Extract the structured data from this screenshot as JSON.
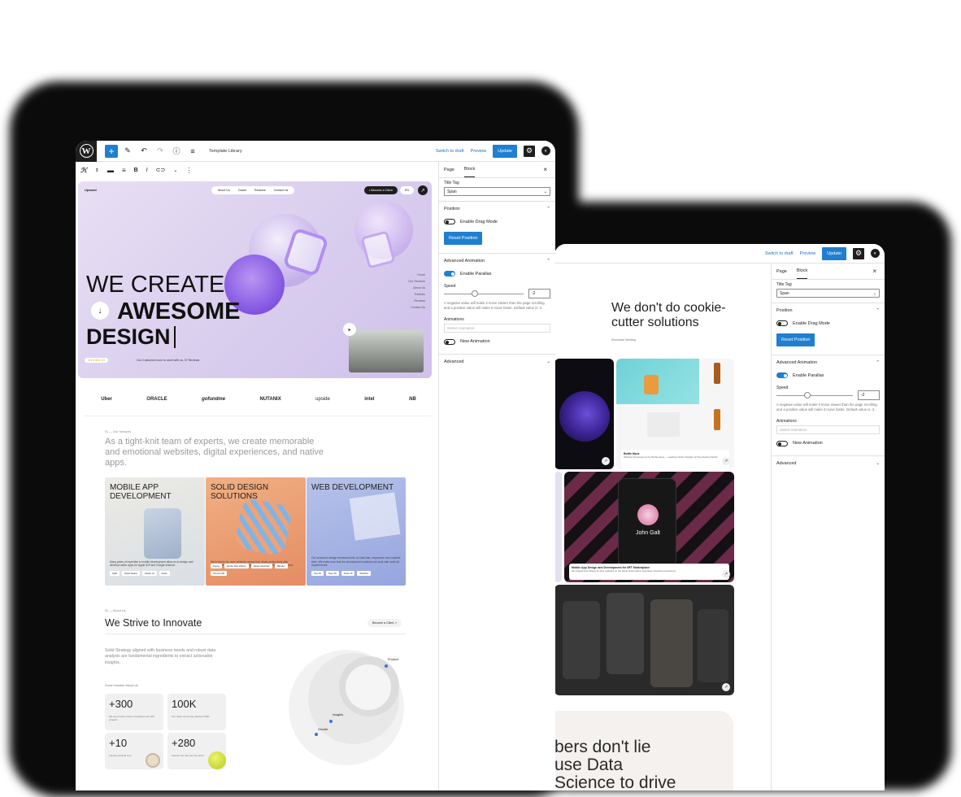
{
  "editor_left": {
    "toolbar": {
      "doc_title": "Template Library",
      "switch_draft": "Switch to draft",
      "preview": "Preview",
      "update": "Update"
    },
    "sidebar": {
      "tab_page": "Page",
      "tab_block": "Block",
      "title_tag_label": "Title Tag",
      "title_tag_value": "Span",
      "position_label": "Position",
      "drag_mode_label": "Enable Drag Mode",
      "reset_position": "Reset Position",
      "advanced_animation_label": "Advanced Animation",
      "parallax_label": "Enable Parallax",
      "speed_label": "Speed",
      "speed_value": "-2",
      "speed_help": "A negative value will make it move slower than the page scrolling, and a positive value will make it move faster. Default value is -2.",
      "animations_label": "Animations",
      "animations_placeholder": "Select Animation",
      "new_animation_label": "New Animation",
      "advanced_label": "Advanced"
    }
  },
  "site": {
    "brand": "Upward",
    "nav": [
      "About Us",
      "Cases",
      "Reviews",
      "Contact Us"
    ],
    "become_client": "Become a Client",
    "lang": "EN",
    "side_menu": [
      "Home",
      "Our Services",
      "About Us",
      "Portfolio",
      "Reviews",
      "Contact Us"
    ],
    "hero_line1": "WE CREATE",
    "hero_line2": "AWESOME",
    "hero_line3": "DESIGN",
    "hero_review": "Our Customers love to work with us, 37 Reviews",
    "logos": [
      "Uber",
      "ORACLE",
      "gofundme",
      "NUTANIX",
      "upside",
      "intel",
      "NB"
    ],
    "services_kicker": "01 — Our Services",
    "services_intro": "As a tight-knit team of experts, we create memorable and emotional websites, digital experiences, and native apps.",
    "cards": [
      {
        "title": "MOBILE APP DEVELOPMENT",
        "text": "Many years of expertise in mobile development allow us to design and develop native apps for Apple iOS and Google Android.",
        "tags": [
          "Swift",
          "React Native",
          "Flutter UI",
          "Kotlin"
        ]
      },
      {
        "title": "SOLID DESIGN SOLUTIONS",
        "text": "We're driven by user-centered design that drives productivity with memorable interfaces that are engaging and actionable for customers.",
        "tags": [
          "Figma",
          "Adobe After Effects",
          "Adobe Illustrator",
          "Blender",
          "Cinema 4D"
        ]
      },
      {
        "title": "WEB DEVELOPMENT",
        "text": "Our seasoned design framework lets us build fast, responsive and scalable sites. We make sure that the development solutions we work with meet all requirements.",
        "tags": [
          "Vue.JS",
          "Next.JS",
          "Node.JS",
          "Webflow"
        ]
      }
    ],
    "about_kicker": "02 — About Us",
    "about_title": "We Strive to Innovate",
    "about_btn": "Become a Client",
    "about_text": "Solid Strategy aligned with business needs and robust data analysis are fundamental ingredients to extract actionable insights.",
    "numbers_label": "Some Number About Us",
    "stats": [
      {
        "value": "+300",
        "text": "We are proud to have completed over 300 projects"
      },
      {
        "value": "100K",
        "text": "Our users count has reached 100K"
      },
      {
        "value": "+10",
        "text": "Industry awards won"
      },
      {
        "value": "+280",
        "text": "Clients from all over the world"
      }
    ],
    "venn_labels": [
      "Product",
      "Insights",
      "Growth"
    ]
  },
  "editor_right": {
    "toolbar": {
      "switch_draft": "Switch to draft",
      "preview": "Preview",
      "update": "Update"
    },
    "heading": "We don't do cookie-cutter solutions",
    "kicker": "Showcase Meeting",
    "cards": [
      {
        "title": "",
        "text": ""
      },
      {
        "title": "Bottle Haus",
        "text": "Website Development for Bottle Haus — Leading Online Retailer of Fine Alcohol Spirits"
      },
      {
        "title": "Mobile App Design and Development for NFT Marketplace",
        "text": "We helped Gen Zkeep its fans updated on the latest drops with a seamless shopping experience"
      }
    ],
    "profile_name": "John Galt",
    "bottom_text_1": "bers don't lie",
    "bottom_text_2": "use Data",
    "bottom_text_3": "Science to drive",
    "sidebar": {
      "tab_page": "Page",
      "tab_block": "Block",
      "title_tag_label": "Title Tag",
      "title_tag_value": "Span",
      "position_label": "Position",
      "drag_mode_label": "Enable Drag Mode",
      "reset_position": "Reset Position",
      "advanced_animation_label": "Advanced Animation",
      "parallax_label": "Enable Parallax",
      "speed_label": "Speed",
      "speed_value": "-2",
      "speed_help": "A negative value will make it move slower than the page scrolling, and a positive value will make it move faster. Default value is -2.",
      "animations_label": "Animations",
      "animations_placeholder": "Select Animation",
      "new_animation_label": "New Animation",
      "advanced_label": "Advanced"
    }
  }
}
